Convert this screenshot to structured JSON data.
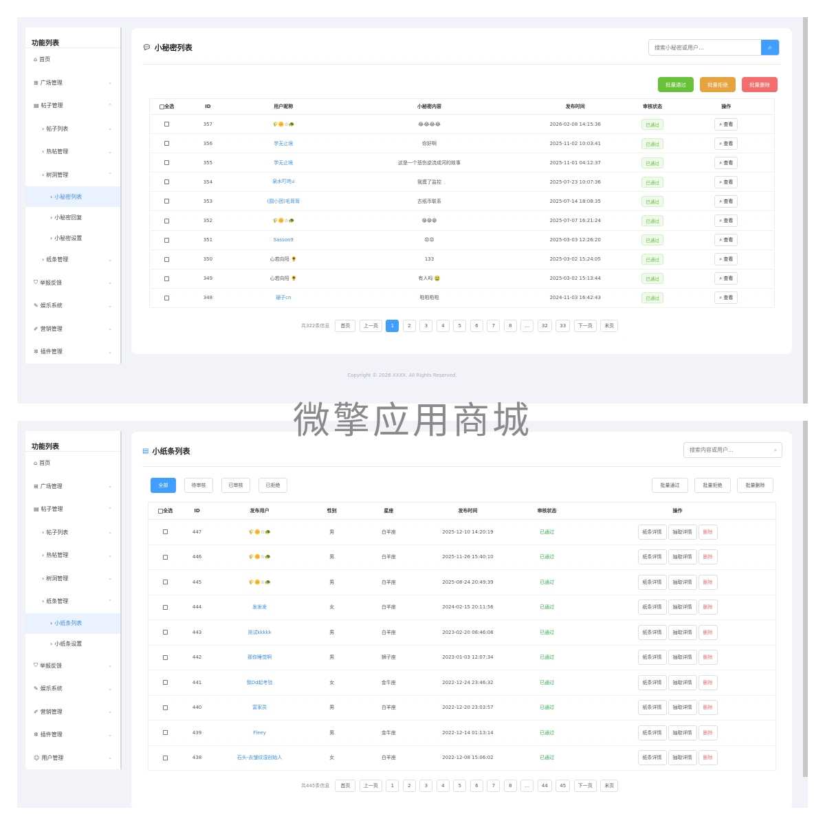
{
  "top": {
    "sidebar": {
      "title": "功能列表",
      "items": [
        {
          "icon": "⌂",
          "label": "首页",
          "chev": ""
        },
        {
          "icon": "⊞",
          "label": "广场管理",
          "chev": "⌄"
        },
        {
          "icon": "▤",
          "label": "帖子管理",
          "chev": "⌃"
        },
        {
          "icon": "›",
          "label": "帖子列表",
          "chev": "⌄"
        },
        {
          "icon": "›",
          "label": "热帖管理",
          "chev": "⌄"
        },
        {
          "icon": "›",
          "label": "树洞管理",
          "chev": "⌃"
        },
        {
          "icon": "›",
          "label": "小秘密列表",
          "chev": ""
        },
        {
          "icon": "›",
          "label": "小秘密回复",
          "chev": ""
        },
        {
          "icon": "›",
          "label": "小秘密设置",
          "chev": ""
        },
        {
          "icon": "›",
          "label": "纸条管理",
          "chev": "⌄"
        },
        {
          "icon": "⛉",
          "label": "举报反馈",
          "chev": "⌄"
        },
        {
          "icon": "✎",
          "label": "娱乐系统",
          "chev": "⌄"
        },
        {
          "icon": "✐",
          "label": "营销管理",
          "chev": "⌄"
        },
        {
          "icon": "✲",
          "label": "插件管理",
          "chev": "⌄"
        }
      ]
    },
    "title": "小秘密列表",
    "search_placeholder": "搜索小秘密或用户...",
    "batch": {
      "approve": "批量通过",
      "reject": "批量拒绝",
      "delete": "批量删除"
    },
    "columns": [
      "全选",
      "ID",
      "用户昵称",
      "小秘密内容",
      "发布时间",
      "审核状态",
      "操作"
    ],
    "rows": [
      {
        "id": "357",
        "user": "🌾🌼☆🐢",
        "content": "😂😂😂😂",
        "time": "2026-02-08 14:15:36",
        "status": "已通过",
        "op": "查看"
      },
      {
        "id": "356",
        "user": "学无止境",
        "content": "你好啊",
        "time": "2025-11-02 10:03:41",
        "status": "已通过",
        "op": "查看"
      },
      {
        "id": "355",
        "user": "学无止境",
        "content": "这是一个悲伤逆流成河的故事",
        "time": "2025-11-01 04:12:37",
        "status": "已通过",
        "op": "查看"
      },
      {
        "id": "354",
        "user": "泉水叮咚ฺu",
        "content": "我摸了监控",
        "time": "2025-07-23 10:07:36",
        "status": "已通过",
        "op": "查看"
      },
      {
        "id": "353",
        "user": "(圆小团)毛茸茸",
        "content": "古纸币联系",
        "time": "2025-07-14 18:08:35",
        "status": "已通过",
        "op": "查看"
      },
      {
        "id": "352",
        "user": "🌾🌼☆🐢",
        "content": "😁😁😁",
        "time": "2025-07-07 16:21:24",
        "status": "已通过",
        "op": "查看"
      },
      {
        "id": "351",
        "user": "Sasson9",
        "content": "😟😟",
        "time": "2025-03-03 12:26:20",
        "status": "已通过",
        "op": "查看"
      },
      {
        "id": "350",
        "user": "心若向阳 🌻",
        "content": "133",
        "time": "2025-03-02 15:24:05",
        "status": "已通过",
        "op": "查看"
      },
      {
        "id": "349",
        "user": "心若向阳 🌻",
        "content": "有人吗 🤮",
        "time": "2025-03-02 15:13:44",
        "status": "已通过",
        "op": "查看"
      },
      {
        "id": "348",
        "user": "珊子cn",
        "content": "啦啦啦啦",
        "time": "2024-11-03 16:42:43",
        "status": "已通过",
        "op": "查看"
      }
    ],
    "pager": {
      "total": "共322条信息",
      "first": "首页",
      "prev": "上一页",
      "pages": [
        "1",
        "2",
        "3",
        "4",
        "5",
        "6",
        "7",
        "8",
        "...",
        "32",
        "33"
      ],
      "next": "下一页",
      "last": "末页"
    },
    "copyright": "Copyright © 2026 XXXX. All Rights Reserved."
  },
  "watermark": "微擎应用商城",
  "bottom": {
    "sidebar": {
      "title": "功能列表",
      "items": [
        {
          "icon": "⌂",
          "label": "首页",
          "chev": ""
        },
        {
          "icon": "⊞",
          "label": "广场管理",
          "chev": "⌄"
        },
        {
          "icon": "▤",
          "label": "帖子管理",
          "chev": "⌃"
        },
        {
          "icon": "›",
          "label": "帖子列表",
          "chev": "⌄"
        },
        {
          "icon": "›",
          "label": "热帖管理",
          "chev": "⌄"
        },
        {
          "icon": "›",
          "label": "树洞管理",
          "chev": "⌄"
        },
        {
          "icon": "›",
          "label": "纸条管理",
          "chev": "⌃"
        },
        {
          "icon": "›",
          "label": "小纸条列表",
          "chev": ""
        },
        {
          "icon": "›",
          "label": "小纸条设置",
          "chev": ""
        },
        {
          "icon": "⛉",
          "label": "举报反馈",
          "chev": "⌄"
        },
        {
          "icon": "✎",
          "label": "娱乐系统",
          "chev": "⌄"
        },
        {
          "icon": "✐",
          "label": "营销管理",
          "chev": "⌄"
        },
        {
          "icon": "✲",
          "label": "插件管理",
          "chev": "⌄"
        },
        {
          "icon": "☺",
          "label": "用户管理",
          "chev": "⌄"
        }
      ]
    },
    "title": "小纸条列表",
    "search_placeholder": "搜索内容或用户...",
    "filters": [
      "全部",
      "待审核",
      "已审核",
      "已拒绝"
    ],
    "batch": {
      "approve": "批量通过",
      "reject": "批量拒绝",
      "delete": "批量删除"
    },
    "columns": [
      "全选",
      "ID",
      "发布用户",
      "性别",
      "星座",
      "发布时间",
      "审核状态",
      "操作"
    ],
    "ops": {
      "detail": "纸条详情",
      "draw": "抽取详情",
      "delete": "删除"
    },
    "rows": [
      {
        "id": "447",
        "user": "🌾🌼☆🐢",
        "gender": "男",
        "sign": "白羊座",
        "time": "2025-12-10 14:20:19",
        "status": "已通过"
      },
      {
        "id": "446",
        "user": "🌾🌼☆🐢",
        "gender": "男",
        "sign": "白羊座",
        "time": "2025-11-26 15:40:10",
        "status": "已通过"
      },
      {
        "id": "445",
        "user": "🌾🌼☆🐢",
        "gender": "男",
        "sign": "白羊座",
        "time": "2025-08-24 20:49:39",
        "status": "已通过"
      },
      {
        "id": "444",
        "user": "发发发",
        "gender": "女",
        "sign": "白羊座",
        "time": "2024-02-15 20:11:56",
        "status": "已通过"
      },
      {
        "id": "443",
        "user": "测试kkkkk",
        "gender": "男",
        "sign": "白羊座",
        "time": "2023-02-20 08:46:08",
        "status": "已通过"
      },
      {
        "id": "442",
        "user": "那你睡觉啊",
        "gender": "男",
        "sign": "狮子座",
        "time": "2023-01-03 12:07:34",
        "status": "已通过"
      },
      {
        "id": "441",
        "user": "我Dd起考验",
        "gender": "女",
        "sign": "金牛座",
        "time": "2022-12-24 23:46:32",
        "status": "已通过"
      },
      {
        "id": "440",
        "user": "富家员",
        "gender": "男",
        "sign": "白羊座",
        "time": "2022-12-20 23:03:57",
        "status": "已通过"
      },
      {
        "id": "439",
        "user": "Fleey",
        "gender": "男",
        "sign": "金牛座",
        "time": "2022-12-14 01:13:14",
        "status": "已通过"
      },
      {
        "id": "438",
        "user": "石头-去皱纹湿创始人",
        "gender": "女",
        "sign": "白羊座",
        "time": "2022-12-08 15:06:02",
        "status": "已通过"
      }
    ],
    "pager": {
      "total": "共445条信息",
      "first": "首页",
      "prev": "上一页",
      "pages": [
        "1",
        "2",
        "3",
        "4",
        "5",
        "6",
        "7",
        "8",
        "...",
        "44",
        "45"
      ],
      "next": "下一页",
      "last": "末页"
    }
  },
  "colors": {
    "primary": "#409eff",
    "green": "#67c23a",
    "orange": "#e6a23c",
    "red": "#f56c6c"
  }
}
